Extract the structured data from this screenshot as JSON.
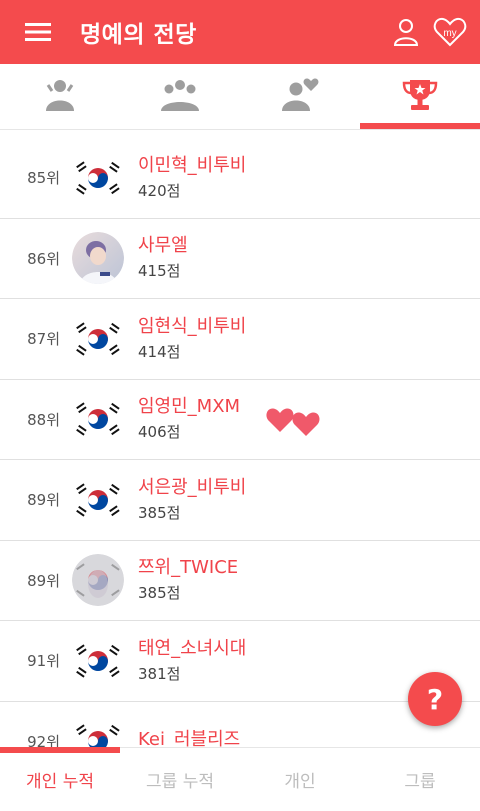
{
  "header": {
    "title": "명예의 전당",
    "menu_icon": "hamburger-menu-icon",
    "profile_icon": "user-profile-icon",
    "my_icon": "my-heart-icon",
    "my_icon_text": "my",
    "color": "#f44b4d"
  },
  "top_tabs": [
    {
      "icon": "single-person-icon",
      "active": false
    },
    {
      "icon": "group-people-icon",
      "active": false
    },
    {
      "icon": "person-heart-icon",
      "active": false
    },
    {
      "icon": "trophy-icon",
      "active": true
    }
  ],
  "ranking": [
    {
      "rank": "85위",
      "name": "이민혁_비투비",
      "score": "420점",
      "avatar": "korean-flag"
    },
    {
      "rank": "86위",
      "name": "사무엘",
      "score": "415점",
      "avatar": "photo"
    },
    {
      "rank": "87위",
      "name": "임현식_비투비",
      "score": "414점",
      "avatar": "korean-flag"
    },
    {
      "rank": "88위",
      "name": "임영민_MXM",
      "score": "406점",
      "avatar": "korean-flag",
      "hearts": true
    },
    {
      "rank": "89위",
      "name": "서은광_비투비",
      "score": "385점",
      "avatar": "korean-flag"
    },
    {
      "rank": "89위",
      "name": "쯔위_TWICE",
      "score": "385점",
      "avatar": "korean-flag-faded"
    },
    {
      "rank": "91위",
      "name": "태연_소녀시대",
      "score": "381점",
      "avatar": "korean-flag"
    },
    {
      "rank": "92위",
      "name": "Kei_러블리즈",
      "score": "",
      "avatar": "korean-flag"
    }
  ],
  "help_button": {
    "label": "?"
  },
  "bottom_tabs": [
    {
      "label": "개인 누적",
      "active": true
    },
    {
      "label": "그룹 누적",
      "active": false
    },
    {
      "label": "개인",
      "active": false
    },
    {
      "label": "그룹",
      "active": false
    }
  ]
}
